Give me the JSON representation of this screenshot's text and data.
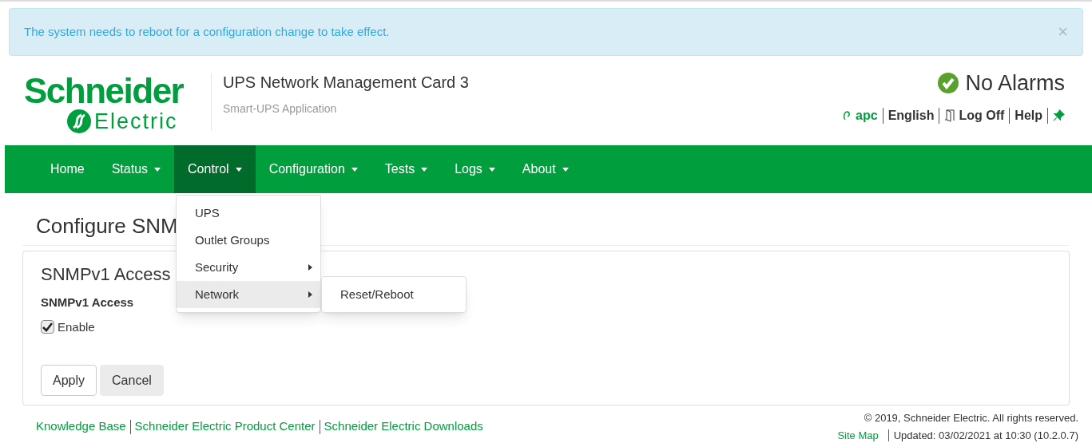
{
  "alert": {
    "message": "The system needs to reboot for a configuration change to take effect.",
    "close": "×"
  },
  "header": {
    "logo_top": "Schneider",
    "logo_bottom": "Electric",
    "title": "UPS Network Management Card 3",
    "subtitle": "Smart-UPS Application",
    "alarm_status": "No Alarms",
    "user_links": [
      {
        "kind": "user",
        "label": "apc"
      },
      {
        "kind": "plain",
        "label": "English"
      },
      {
        "kind": "logoff",
        "label": "Log Off"
      },
      {
        "kind": "plain",
        "label": "Help"
      },
      {
        "kind": "pin"
      }
    ]
  },
  "nav": {
    "items": [
      {
        "label": "Home",
        "dropdown": false,
        "selected": false
      },
      {
        "label": "Status",
        "dropdown": true,
        "selected": false
      },
      {
        "label": "Control",
        "dropdown": true,
        "selected": true
      },
      {
        "label": "Configuration",
        "dropdown": true,
        "selected": false
      },
      {
        "label": "Tests",
        "dropdown": true,
        "selected": false
      },
      {
        "label": "Logs",
        "dropdown": true,
        "selected": false
      },
      {
        "label": "About",
        "dropdown": true,
        "selected": false
      }
    ]
  },
  "dropdown_menu": {
    "items": [
      {
        "label": "UPS",
        "submenu": false,
        "selected": false
      },
      {
        "label": "Outlet Groups",
        "submenu": false,
        "selected": false
      },
      {
        "label": "Security",
        "submenu": true,
        "selected": false
      },
      {
        "label": "Network",
        "submenu": true,
        "selected": true
      }
    ],
    "submenu": {
      "items": [
        {
          "label": "Reset/Reboot"
        }
      ]
    }
  },
  "page_title": "Configure SNM",
  "panel": {
    "heading": "SNMPv1 Access",
    "field_label": "SNMPv1 Access",
    "checkbox": {
      "label": "Enable",
      "checked": true
    },
    "buttons": [
      {
        "label": "Apply",
        "kind": "default"
      },
      {
        "label": "Cancel",
        "kind": "secondary"
      }
    ]
  },
  "footer": {
    "links": [
      "Knowledge Base",
      "Schneider Electric Product Center",
      "Schneider Electric Downloads"
    ],
    "copyright": "© 2019, Schneider Electric. All rights reserved.",
    "site_map": "Site Map",
    "updated": "Updated: 03/02/2021 at 10:30 (10.2.0.7)"
  }
}
